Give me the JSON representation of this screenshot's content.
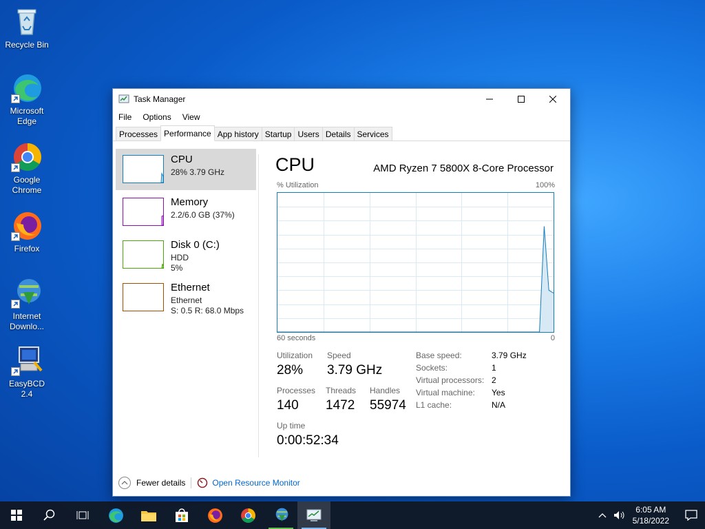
{
  "desktop": {
    "icons": [
      {
        "label": "Recycle Bin",
        "icon": "recycle-bin-icon"
      },
      {
        "label": "Microsoft Edge",
        "icon": "edge-icon"
      },
      {
        "label": "Google Chrome",
        "icon": "chrome-icon"
      },
      {
        "label": "Firefox",
        "icon": "firefox-icon"
      },
      {
        "label": "Internet Downlo...",
        "icon": "internet-download-manager-icon"
      },
      {
        "label": "EasyBCD 2.4",
        "icon": "easybcd-icon"
      }
    ]
  },
  "window": {
    "title": "Task Manager",
    "menu": [
      "File",
      "Options",
      "View"
    ],
    "tabs": [
      "Processes",
      "Performance",
      "App history",
      "Startup",
      "Users",
      "Details",
      "Services"
    ],
    "active_tab": "Performance"
  },
  "sidebar": {
    "items": [
      {
        "name": "CPU",
        "line1": "28%  3.79 GHz",
        "line2": "",
        "color": "#117dbb"
      },
      {
        "name": "Memory",
        "line1": "2.2/6.0 GB (37%)",
        "line2": "",
        "color": "#8b12ae"
      },
      {
        "name": "Disk 0 (C:)",
        "line1": "HDD",
        "line2": "5%",
        "color": "#4da60c"
      },
      {
        "name": "Ethernet",
        "line1": "Ethernet",
        "line2": "S: 0.5  R: 68.0 Mbps",
        "color": "#a74f01"
      }
    ]
  },
  "cpu": {
    "title": "CPU",
    "model": "AMD Ryzen 7 5800X 8-Core Processor",
    "graph_label_left": "% Utilization",
    "graph_label_right": "100%",
    "graph_footer_left": "60 seconds",
    "graph_footer_right": "0",
    "utilization_history": [
      0,
      0,
      0,
      0,
      0,
      0,
      0,
      0,
      0,
      0,
      0,
      0,
      0,
      0,
      0,
      0,
      0,
      0,
      0,
      0,
      0,
      0,
      0,
      0,
      0,
      0,
      0,
      0,
      0,
      0,
      0,
      0,
      0,
      0,
      0,
      0,
      0,
      0,
      0,
      0,
      0,
      0,
      0,
      0,
      0,
      0,
      0,
      0,
      0,
      0,
      0,
      0,
      0,
      0,
      0,
      0,
      0,
      76,
      30,
      28
    ],
    "stats": {
      "utilization_label": "Utilization",
      "utilization": "28%",
      "speed_label": "Speed",
      "speed": "3.79 GHz",
      "processes_label": "Processes",
      "processes": "140",
      "threads_label": "Threads",
      "threads": "1472",
      "handles_label": "Handles",
      "handles": "55974",
      "uptime_label": "Up time",
      "uptime": "0:00:52:34"
    },
    "specs": [
      {
        "label": "Base speed:",
        "value": "3.79 GHz"
      },
      {
        "label": "Sockets:",
        "value": "1"
      },
      {
        "label": "Virtual processors:",
        "value": "2"
      },
      {
        "label": "Virtual machine:",
        "value": "Yes"
      },
      {
        "label": "L1 cache:",
        "value": "N/A"
      }
    ]
  },
  "footer": {
    "fewer_details": "Fewer details",
    "resource_monitor": "Open Resource Monitor"
  },
  "taskbar": {
    "time": "6:05 AM",
    "date": "5/18/2022"
  },
  "colors": {
    "cpu_accent": "#117dbb",
    "link": "#0066cc"
  }
}
